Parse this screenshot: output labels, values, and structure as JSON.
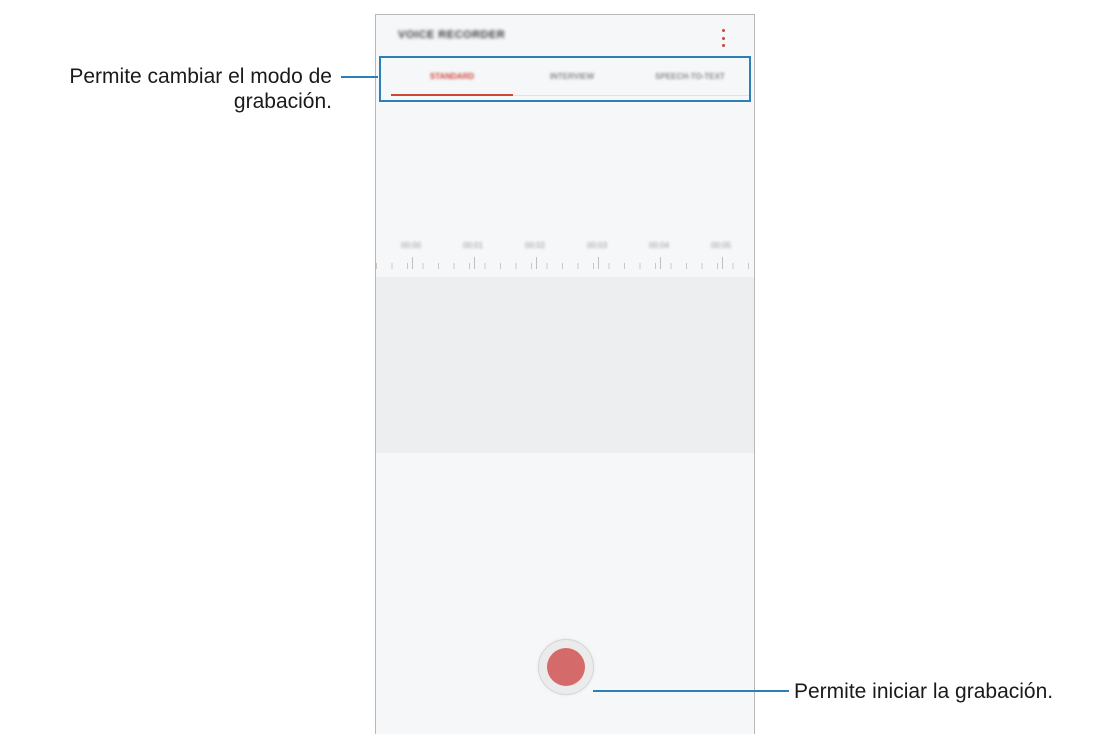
{
  "app": {
    "title": "VOICE RECORDER",
    "more_icon": "more-vertical-icon"
  },
  "tabs": [
    {
      "label": "STANDARD",
      "active": true
    },
    {
      "label": "INTERVIEW",
      "active": false
    },
    {
      "label": "SPEECH-TO-TEXT",
      "active": false
    }
  ],
  "timeline": {
    "labels": [
      "00:00",
      "00:01",
      "00:02",
      "00:03",
      "00:04",
      "00:05"
    ]
  },
  "record_button": {
    "icon": "record-icon",
    "color": "#d56a6a"
  },
  "callouts": {
    "mode_line1": "Permite cambiar el modo de",
    "mode_line2": "grabación.",
    "record": "Permite iniciar la grabación."
  },
  "colors": {
    "accent": "#d0463b",
    "callout_line": "#2e7fb8"
  }
}
